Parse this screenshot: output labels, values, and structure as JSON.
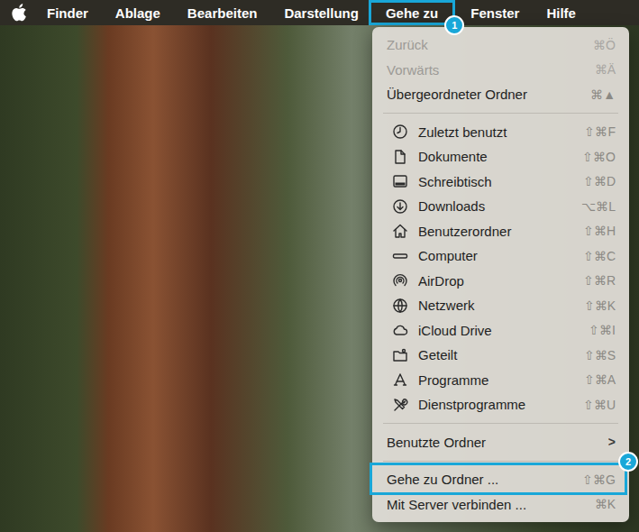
{
  "menubar": {
    "app": "Finder",
    "items": [
      {
        "label": "Ablage",
        "selected": false
      },
      {
        "label": "Bearbeiten",
        "selected": false
      },
      {
        "label": "Darstellung",
        "selected": false
      },
      {
        "label": "Gehe zu",
        "selected": true,
        "badge": "1"
      },
      {
        "label": "Fenster",
        "selected": false
      },
      {
        "label": "Hilfe",
        "selected": false
      }
    ]
  },
  "menu": {
    "groups": [
      [
        {
          "label": "Zurück",
          "shortcut": "⌘Ö",
          "kind": "plain",
          "disabled": true,
          "selected": false
        },
        {
          "label": "Vorwärts",
          "shortcut": "⌘Ä",
          "kind": "plain",
          "disabled": true,
          "selected": false
        },
        {
          "label": "Übergeordneter Ordner",
          "shortcut": "⌘▲",
          "kind": "plain",
          "disabled": false,
          "selected": false
        }
      ],
      [
        {
          "label": "Zuletzt benutzt",
          "shortcut": "⇧⌘F",
          "kind": "icon",
          "disabled": false,
          "selected": false
        },
        {
          "label": "Dokumente",
          "shortcut": "⇧⌘O",
          "kind": "icon",
          "disabled": false,
          "selected": false
        },
        {
          "label": "Schreibtisch",
          "shortcut": "⇧⌘D",
          "kind": "icon",
          "disabled": false,
          "selected": false
        },
        {
          "label": "Downloads",
          "shortcut": "⌥⌘L",
          "kind": "icon",
          "disabled": false,
          "selected": false
        },
        {
          "label": "Benutzerordner",
          "shortcut": "⇧⌘H",
          "kind": "icon",
          "disabled": false,
          "selected": false
        },
        {
          "label": "Computer",
          "shortcut": "⇧⌘C",
          "kind": "icon",
          "disabled": false,
          "selected": false
        },
        {
          "label": "AirDrop",
          "shortcut": "⇧⌘R",
          "kind": "icon",
          "disabled": false,
          "selected": false
        },
        {
          "label": "Netzwerk",
          "shortcut": "⇧⌘K",
          "kind": "icon",
          "disabled": false,
          "selected": false
        },
        {
          "label": "iCloud Drive",
          "shortcut": "⇧⌘I",
          "kind": "icon",
          "disabled": false,
          "selected": false
        },
        {
          "label": "Geteilt",
          "shortcut": "⇧⌘S",
          "kind": "icon",
          "disabled": false,
          "selected": false
        },
        {
          "label": "Programme",
          "shortcut": "⇧⌘A",
          "kind": "icon",
          "disabled": false,
          "selected": false
        },
        {
          "label": "Dienstprogramme",
          "shortcut": "⇧⌘U",
          "kind": "icon",
          "disabled": false,
          "selected": false
        }
      ],
      [
        {
          "label": "Benutzte Ordner",
          "shortcut": ">",
          "kind": "submenu",
          "disabled": false,
          "selected": false
        }
      ],
      [
        {
          "label": "Gehe zu Ordner ...",
          "shortcut": "⇧⌘G",
          "kind": "plain",
          "disabled": false,
          "selected": true,
          "badge": "2"
        },
        {
          "label": "Mit Server verbinden ...",
          "shortcut": "⌘K",
          "kind": "plain",
          "disabled": false,
          "selected": false
        }
      ]
    ]
  }
}
